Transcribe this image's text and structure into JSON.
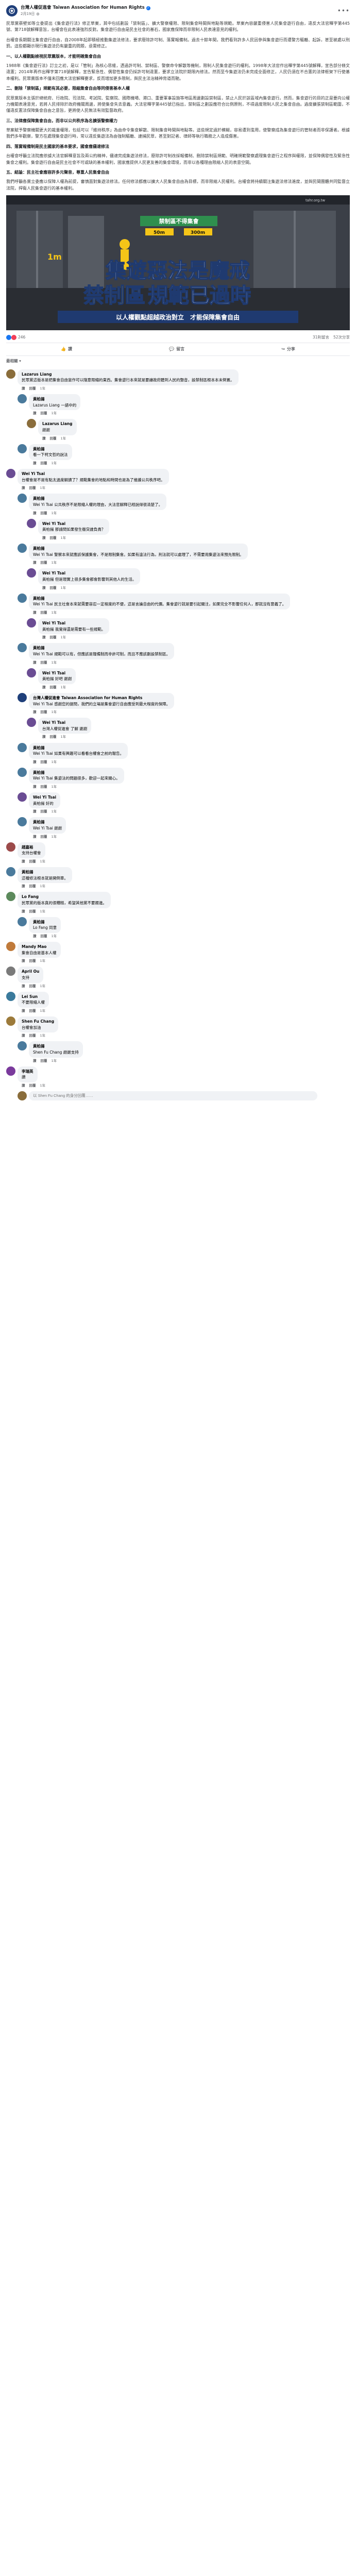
{
  "post": {
    "page_name": "台灣人權促進會 Taiwan Association for Human Rights",
    "time": "2月19日",
    "privacy_icon": "globe-icon",
    "paragraphs": [
      "民眾黨蔡壁如等立委提出《集會遊行法》修正草案，其中包括劃設「禁制區」、擴大警察權限、限制集會時間與地點等規範。草案內容嚴重侵害人民集會遊行自由，違反大法官釋字第445號、第718號解釋意旨，台權會在此表達強烈反對。集會遊行自由是民主社會的基石，國家應保障而非限制人民表達意見的權利。",
      "台權會長期關注集會遊行自由，自2008年起即積極推動集遊法修法，要求廢除許可制、落實報備制。過去十餘年間，我們看到許多人民因參與集會遊行而遭警方驅離、起訴，甚至被處以刑罰。這些都顯示現行集遊法仍有嚴重的問題，亟需修正。"
    ],
    "sections": [
      {
        "heading": "一、以人權觀點檢視民眾黨版本，才能明確集會自由",
        "text": "1988年《集會遊行法》訂立之初，是以「管制」為核心思維，透過許可制、禁制區、警察命令解散等機制，限制人民集會遊行的權利。1998年大法官作出釋字第445號解釋，宣告部分條文違憲；2014年再作出釋字第718號解釋，宣告緊急性、偶發性集會仍採許可制違憲，要求立法院於期限內修法。然而至今集遊法仍未完成全面修正，人民仍須在不合憲的法律框架下行使基本權利。民眾黨版本不僅未回應大法官解釋要求，反而增加更多限制，與民主法治精神背道而馳。"
      },
      {
        "heading": "二、刪除「禁制區」規範有其必要，限縮集會自由等同侵害基本人權",
        "text": "民眾黨版本主張於總統府、行政院、司法院、考試院、監察院、國際機場、港口、重要軍事設施等地區周邊劃設禁制區，禁止人民於該區域內集會遊行。然而，集會遊行的目的正是要向公權力機關表達意見，若將人民排除於政府機關周邊，將使集會失去意義。大法官釋字第445號已指出，禁制區之劃設應符合比例原則，不得過度限制人民之集會自由。過度擴張禁制區範圍，不僅違反憲法保障集會自由之意旨，更將使人民無法有效監督政府。"
      },
      {
        "heading": "三、法律應保障集會自由，而非以公共秩序為名擴張警察權力",
        "text": "草案賦予警察機關更大的裁量權限，包括可以「維持秩序」為由命令集會解散、限制集會時間與地點等。這些規定過於模糊，容易遭到濫用，使警察成為集會遊行的管制者而非保護者。根據我們多年觀察，警方在處理集會遊行時，常以違反集遊法為由強制驅離、逮捕民眾，甚至對記者、律師等執行職務之人造成傷害。"
      },
      {
        "heading": "四、落實報備制是民主國家的基本要求，國會應儘速修法",
        "text": "台權會呼籲立法院應依據大法官解釋意旨及兩公約精神，儘速完成集遊法修法，廢除許可制改採報備制、刪除禁制區規範、明確規範警察處理集會遊行之程序與權限，並保障偶發性及緊急性集會之權利。集會遊行自由是民主社會不可或缺的基本權利，國家應提供人民更友善的集會環境，而非以各種理由限縮人民的表意空間。"
      },
      {
        "heading": "五、結論：民主社會應容許多元聲音，尊重人民集會自由",
        "text": "我們呼籲各黨立委應以保障人權為前提，審慎面對集遊法修法。任何修法都應以擴大人民集會自由為目標，而非限縮人民權利。台權會將持續關注集遊法修法進度，並與民間團體共同監督立法院，捍衛人民集會遊行的基本權利。"
      }
    ],
    "image": {
      "sign_title": "禁制區不得集會",
      "sign_left": "50m",
      "sign_right": "300m",
      "headline_line1": "集遊惡法是魔戒",
      "headline_line2_a": "禁制區",
      "headline_line2_b": "規範已過時",
      "banner": "以人權觀點超越政治對立　才能保障集會自由",
      "watermark": "tahr.org.tw",
      "distance_marker": "1m",
      "colors": {
        "overlay_yellow": "#f5c518",
        "sign_green": "#2f8f4e",
        "banner_blue": "#1f3a70"
      }
    },
    "reactions_count": "246",
    "comments_count": "31則留言",
    "shares_count": "52次分享",
    "like_label": "讚",
    "comment_label": "留言",
    "share_label": "分享",
    "sort_label": "最相關"
  },
  "comments": [
    {
      "level": 0,
      "author": "Lazarus Liang",
      "text": "民眾黨這版本是把集會自由當作可以隨意限縮的東西。集會遊行本來就是要讓政府聽到人民的聲音，設禁制區根本本末倒置。",
      "time": "1年",
      "color": "#8a6d3b"
    },
    {
      "level": 1,
      "author": "黃柏揚",
      "text": "Lazarus Liang 一語中的",
      "time": "1年",
      "color": "#4a7a9c"
    },
    {
      "level": 2,
      "author": "Lazarus Liang",
      "text": "謝謝",
      "time": "1年",
      "color": "#8a6d3b"
    },
    {
      "level": 1,
      "author": "黃柏揚",
      "text": "看一下柯文哲的說法",
      "time": "1年",
      "color": "#4a7a9c",
      "preview": true
    },
    {
      "level": 0,
      "author": "Wei Yi Tsai",
      "text": "台權會是不是有點太過度解讀了？規範集會的地點和時間也是為了維護公共秩序吧。",
      "time": "1年",
      "color": "#6a4c93"
    },
    {
      "level": 1,
      "author": "黃柏揚",
      "text": "Wei Yi Tsai 公共秩序不是限縮人權的理由，大法官解釋已經說得很清楚了。",
      "time": "1年",
      "color": "#4a7a9c"
    },
    {
      "level": 2,
      "author": "Wei Yi Tsai",
      "text": "黃柏揚 那請問如果發生衝突誰負責？",
      "time": "1年",
      "color": "#6a4c93"
    },
    {
      "level": 1,
      "author": "黃柏揚",
      "text": "Wei Yi Tsai 警察本來就應該保護集會，不是限制集會。如果有違法行為，刑法就可以處理了，不需要用集遊法來預先限制。",
      "time": "1年",
      "color": "#4a7a9c"
    },
    {
      "level": 2,
      "author": "Wei Yi Tsai",
      "text": "黃柏揚 但是現實上很多集會都會影響到其他人的生活。",
      "time": "1年",
      "color": "#6a4c93"
    },
    {
      "level": 1,
      "author": "黃柏揚",
      "text": "Wei Yi Tsai 民主社會本來就需要容忍一定程度的不便，這是言論自由的代價。集會遊行就是要引起關注，如果完全不影響任何人，那就沒有意義了。",
      "time": "1年",
      "color": "#4a7a9c"
    },
    {
      "level": 2,
      "author": "Wei Yi Tsai",
      "text": "黃柏揚 我覺得還是需要有一些規範。",
      "time": "1年",
      "color": "#6a4c93"
    },
    {
      "level": 1,
      "author": "黃柏揚",
      "text": "Wei Yi Tsai 規範可以有，但應該是報備制而非許可制，而且不應該劃設禁制區。",
      "time": "1年",
      "color": "#4a7a9c"
    },
    {
      "level": 2,
      "author": "Wei Yi Tsai",
      "text": "黃柏揚 好吧 謝謝",
      "time": "1年",
      "color": "#6a4c93"
    },
    {
      "level": 1,
      "author": "台灣人權促進會 Taiwan Association for Human Rights",
      "text": "Wei Yi Tsai 感謝您的提問，我們的立場是集會遊行自由應受到最大程度的保障。",
      "time": "1年",
      "color": "#1f3f7a"
    },
    {
      "level": 2,
      "author": "Wei Yi Tsai",
      "text": "台灣人權促進會 了解 謝謝",
      "time": "1年",
      "color": "#6a4c93"
    },
    {
      "level": 1,
      "author": "黃柏揚",
      "text": "Wei Yi Tsai 如果有興趣可以看看台權會之前的報告。",
      "time": "1年",
      "color": "#4a7a9c"
    },
    {
      "level": 1,
      "author": "黃柏揚",
      "text": "Wei Yi Tsai 集遊法的問題很多，歡迎一起來關心。",
      "time": "1年",
      "color": "#4a7a9c"
    },
    {
      "level": 1,
      "author": "Wei Yi Tsai",
      "text": "黃柏揚 好的",
      "time": "1年",
      "color": "#6a4c93"
    },
    {
      "level": 1,
      "author": "黃柏揚",
      "text": "Wei Yi Tsai 謝謝",
      "time": "1年",
      "color": "#4a7a9c"
    },
    {
      "level": 0,
      "author": "趙嘉裕",
      "text": "支持台權會",
      "time": "1年",
      "color": "#9c4a4a"
    },
    {
      "level": 0,
      "author": "黃柏揚",
      "text": "這種修法根本就是開倒車。",
      "time": "1年",
      "color": "#4a7a9c"
    },
    {
      "level": 0,
      "author": "Lo Fang",
      "text": "民眾黨的版本真的很糟糕，希望其他黨不要跟進。",
      "time": "1年",
      "color": "#5c8a5c"
    },
    {
      "level": 1,
      "author": "黃柏揚",
      "text": "Lo Fang 同意",
      "time": "1年",
      "color": "#4a7a9c"
    },
    {
      "level": 0,
      "author": "Mandy Mao",
      "text": "集會自由是基本人權",
      "time": "1年",
      "color": "#c07a3a"
    },
    {
      "level": 0,
      "author": "April Ou",
      "text": "支持",
      "time": "1年",
      "color": "#7a7a7a"
    },
    {
      "level": 0,
      "author": "Lei Sun",
      "text": "不要限縮人權",
      "time": "1年",
      "color": "#3a7a9c"
    },
    {
      "level": 0,
      "author": "Shen Fu Chang",
      "text": "台權會加油",
      "time": "1年",
      "color": "#9c7a3a"
    },
    {
      "level": 1,
      "author": "黃柏揚",
      "text": "Shen Fu Chang 謝謝支持",
      "time": "1年",
      "color": "#4a7a9c"
    },
    {
      "level": 0,
      "author": "李瑞英",
      "text": "讚",
      "time": "1年",
      "color": "#7a3a9c"
    }
  ],
  "ui": {
    "reply_label": "回覆",
    "like_label": "讚",
    "more_replies": "查看更多回覆",
    "write_reply_placeholder": "以 Shen Fu Chang 的身分回覆……",
    "write_reply_placeholder_2": "以 Lazarus Liang 的身分回覆……"
  }
}
